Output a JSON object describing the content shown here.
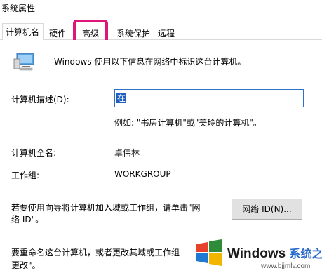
{
  "window": {
    "title": "系统属性"
  },
  "tabs": [
    {
      "label": "计算机名"
    },
    {
      "label": "硬件"
    },
    {
      "label": "高级"
    },
    {
      "label": "系统保护"
    },
    {
      "label": "远程"
    }
  ],
  "active_tab": "计算机名",
  "highlighted_tab": "高级",
  "highlight_color": "#e0157a",
  "panel": {
    "intro": "Windows 使用以下信息在网络中标识这台计算机。",
    "description_label": "计算机描述(D):",
    "description_value": "在",
    "description_example": "例如: \"书房计算机\"或\"美玲的计算机\"。",
    "full_name_label": "计算机全名:",
    "full_name_value": "卓伟林",
    "workgroup_label": "工作组:",
    "workgroup_value": "WORKGROUP",
    "network_id_text_1": "若要使用向导将计算机加入域或工作组，请单击\"网",
    "network_id_text_2": "络 ID\"。",
    "network_id_button": "网络 ID(N)...",
    "rename_text_1": "要重命名这台计算机，或者更改其域或工作组",
    "rename_text_2": "更改\"。"
  },
  "watermark": {
    "brand": "Windows",
    "brand_cn": "系统之家",
    "url": "www.bjjmlv.com"
  },
  "icons": [
    "computer-icon",
    "windows-logo-icon"
  ]
}
